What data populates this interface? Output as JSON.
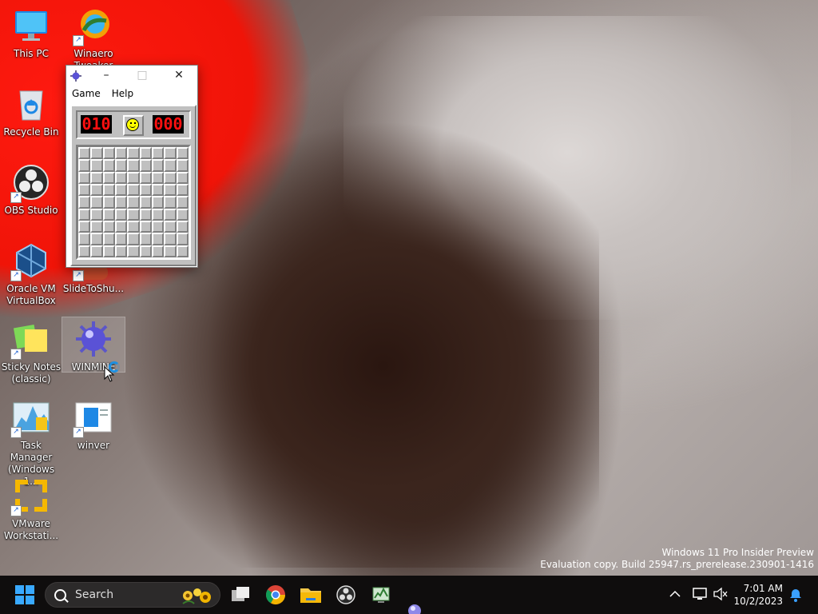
{
  "desktop": {
    "icons": [
      {
        "label": "This PC"
      },
      {
        "label": "Winaero Tweaker"
      },
      {
        "label": "Recycle Bin"
      },
      {
        "label": "OBS Studio"
      },
      {
        "label": "Oracle VM VirtualBox"
      },
      {
        "label": "SlideToShu..."
      },
      {
        "label": "Sticky Notes (classic)"
      },
      {
        "label": "WINMINE"
      },
      {
        "label": "Task Manager (Windows 1..."
      },
      {
        "label": "winver"
      },
      {
        "label": "VMware Workstati..."
      }
    ]
  },
  "minesweeper": {
    "menu": {
      "game": "Game",
      "help": "Help"
    },
    "mine_counter": "010",
    "timer": "000",
    "grid": {
      "rows": 9,
      "cols": 9
    },
    "colors": {
      "face": "#c0c0c0",
      "digits": "#ff1010"
    }
  },
  "watermark": {
    "line1": "Windows 11 Pro Insider Preview",
    "line2": "Evaluation copy. Build 25947.rs_prerelease.230901-1416"
  },
  "taskbar": {
    "search_placeholder": "Search",
    "apps": [
      "task-view-icon",
      "chrome-icon",
      "file-explorer-icon",
      "obs-icon",
      "task-manager-icon"
    ],
    "clock": {
      "time": "7:01 AM",
      "date": "10/2/2023"
    }
  }
}
